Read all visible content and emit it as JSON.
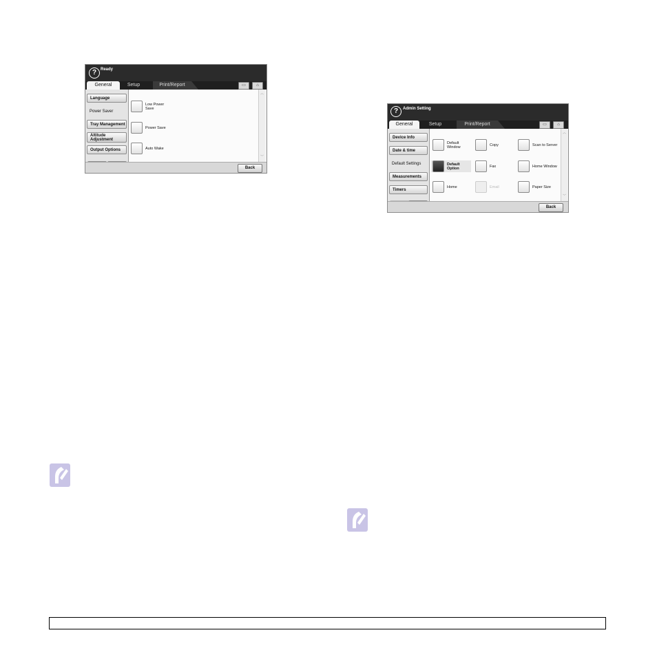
{
  "screen1": {
    "title": "Ready",
    "help_glyph": "?",
    "tabs": [
      {
        "label": "General",
        "active": true
      },
      {
        "label": "Setup",
        "active": false
      },
      {
        "label": "Print/Report",
        "active": false
      }
    ],
    "toolbar_icons": [
      "window-icon",
      "home-icon"
    ],
    "sidebar": [
      {
        "label": "Language",
        "selected": false
      },
      {
        "label": "Power Saver",
        "selected": true
      },
      {
        "label": "Tray Management",
        "selected": false
      },
      {
        "label": "Altitude Adjustment",
        "selected": false
      },
      {
        "label": "Output Options",
        "selected": false
      }
    ],
    "nav_up": "▲",
    "nav_down": "▼",
    "options": [
      {
        "label": "Low Power Save"
      },
      {
        "label": "Power Save"
      },
      {
        "label": "Auto Wake"
      }
    ],
    "back_label": "Back"
  },
  "screen2": {
    "title": "Admin Setting",
    "help_glyph": "?",
    "tabs": [
      {
        "label": "General",
        "active": true
      },
      {
        "label": "Setup",
        "active": false
      },
      {
        "label": "Print/Report",
        "active": false
      }
    ],
    "toolbar_icons": [
      "window-icon",
      "home-icon"
    ],
    "sidebar": [
      {
        "label": "Device Info",
        "selected": false
      },
      {
        "label": "Date & time",
        "selected": false
      },
      {
        "label": "Default Settings",
        "selected": true
      },
      {
        "label": "Measurements",
        "selected": false
      },
      {
        "label": "Timers",
        "selected": false
      }
    ],
    "nav_up": "▲",
    "nav_down": "▼",
    "options": [
      {
        "label": "Default Window",
        "state": "normal"
      },
      {
        "label": "Copy",
        "state": "normal"
      },
      {
        "label": "Scan to Server",
        "state": "normal"
      },
      {
        "label": "Default Option",
        "state": "selected"
      },
      {
        "label": "Fax",
        "state": "normal"
      },
      {
        "label": "Home Window",
        "state": "normal"
      },
      {
        "label": "Home",
        "state": "normal"
      },
      {
        "label": "Email",
        "state": "disabled"
      },
      {
        "label": "Paper Size",
        "state": "normal"
      }
    ],
    "back_label": "Back"
  },
  "colors": {
    "titlebar": "#2b2b2b",
    "note_icon": "#c9c4e6"
  },
  "icons": [
    "help-icon",
    "window-icon",
    "home-icon",
    "note-icon"
  ]
}
